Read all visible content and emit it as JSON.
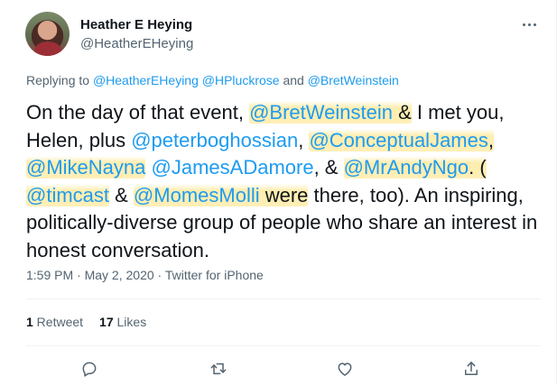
{
  "author": {
    "name": "Heather E Heying",
    "handle": "@HeatherEHeying"
  },
  "replying": {
    "prefix": "Replying to ",
    "mentions": [
      "@HeatherEHeying",
      "@HPluckrose",
      "@BretWeinstein"
    ],
    "sep1": " ",
    "sep2": " and "
  },
  "tweet": {
    "p1": "On the day of that event, ",
    "m1": "@BretWeinstein",
    "p2": " ",
    "p3": "&",
    "p4": " I met you, Helen, plus ",
    "m2": "@peterboghossian",
    "p5": ", ",
    "m3": "@ConceptualJames",
    "p6": ",",
    "m4": "@MikeNayna",
    "p7": " ",
    "m5": "@JamesADamore",
    "p8": ", & ",
    "m6": "@MrAndyNgo",
    "p9": ". (",
    "m7": "@timcast",
    "p10": " & ",
    "m8": "@MomesMolli",
    "p11": " were",
    "p12": " there, too). An inspiring, politically-diverse group of people who share an interest in honest conversation."
  },
  "meta": {
    "time": "1:59 PM",
    "dot1": " · ",
    "date": "May 2, 2020",
    "dot2": " · ",
    "source": "Twitter for iPhone"
  },
  "stats": {
    "retweets_count": "1",
    "retweets_label": " Retweet",
    "likes_count": "17",
    "likes_label": " Likes"
  },
  "icons": {
    "reply": "reply-icon",
    "retweet": "retweet-icon",
    "like": "heart-icon",
    "share": "share-icon",
    "more": "more-icon"
  },
  "colors": {
    "link": "#1d9bf0",
    "secondary": "#536471",
    "text": "#0f1419",
    "highlight": "#ffeaa0"
  }
}
